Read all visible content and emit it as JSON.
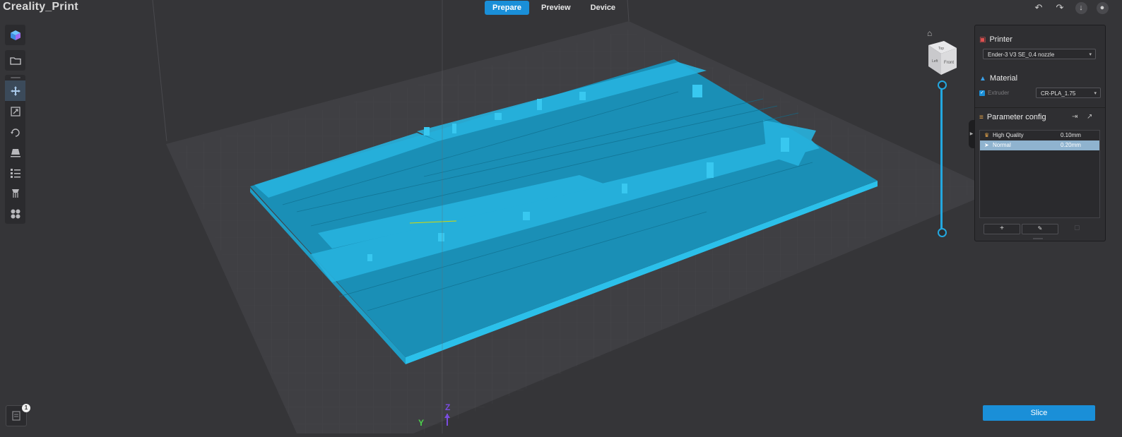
{
  "app": {
    "title": "Creality_Print"
  },
  "tabs": [
    {
      "label": "Prepare",
      "active": true
    },
    {
      "label": "Preview",
      "active": false
    },
    {
      "label": "Device",
      "active": false
    }
  ],
  "topright_icons": [
    "undo-icon",
    "redo-icon",
    "download-icon",
    "user-icon"
  ],
  "toolbar": {
    "top": [
      "cube-icon",
      "folder-open-icon"
    ],
    "tools": [
      "move-icon",
      "scale-icon",
      "rotate-icon",
      "lay-flat-icon",
      "list-icon",
      "support-icon",
      "arrange-icon"
    ]
  },
  "notifications": {
    "count": "1"
  },
  "navcube": {
    "top": "Top",
    "left": "Left",
    "front": "Front"
  },
  "axes": {
    "y": "Y",
    "z": "Z"
  },
  "panel": {
    "printer": {
      "title": "Printer",
      "value": "Ender-3 V3 SE_0.4 nozzle"
    },
    "material": {
      "title": "Material",
      "extruder_label": "Extruder",
      "extruder_checked": true,
      "value": "CR-PLA_1.75"
    },
    "params": {
      "title": "Parameter config",
      "profiles": [
        {
          "name": "High Quality",
          "value": "0.10mm",
          "icon": "crown-icon",
          "selected": false
        },
        {
          "name": "Normal",
          "value": "0.20mm",
          "icon": "rocket-icon",
          "selected": true
        }
      ]
    }
  },
  "slice": {
    "label": "Slice"
  },
  "colors": {
    "accent": "#1a8fd8",
    "model": "#23b4e0",
    "background": "#353538"
  }
}
